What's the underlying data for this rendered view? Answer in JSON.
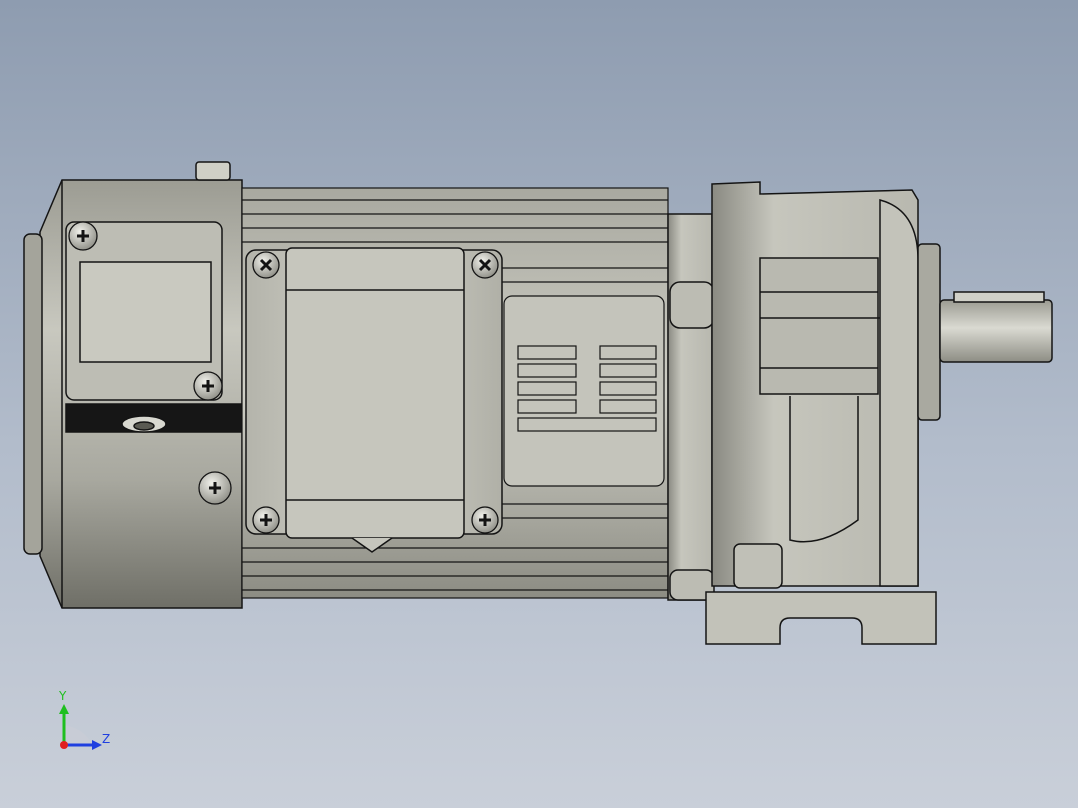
{
  "viewport": {
    "background_top": "#8e9cb0",
    "background_bottom": "#c9cfd9"
  },
  "model": {
    "body_color": "#c3c3b9",
    "shadow_color": "#7e7e75",
    "edge_color": "#141414"
  },
  "triad": {
    "y_label": "Y",
    "z_label": "Z",
    "y_color": "#1fbf1f",
    "z_color": "#1f3fe0",
    "x_color": "#e01f1f"
  }
}
